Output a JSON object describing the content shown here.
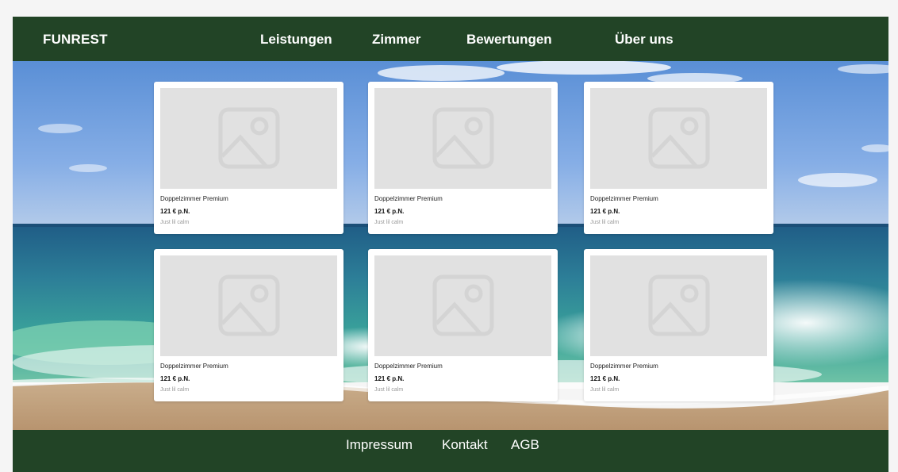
{
  "header": {
    "logo": "FUNREST",
    "nav": [
      {
        "label": "Leistungen"
      },
      {
        "label": "Zimmer"
      },
      {
        "label": "Bewertungen"
      },
      {
        "label": "Über uns"
      }
    ]
  },
  "hero": {
    "background": "beach-with-waves-image"
  },
  "rooms": [
    {
      "title": "Doppelzimmer Premium",
      "price": "121 € p.N.",
      "note": "Just lil calm",
      "image": "image-placeholder-icon"
    },
    {
      "title": "Doppelzimmer Premium",
      "price": "121 € p.N.",
      "note": "Just lil calm",
      "image": "image-placeholder-icon"
    },
    {
      "title": "Doppelzimmer Premium",
      "price": "121 € p.N.",
      "note": "Just lil calm",
      "image": "image-placeholder-icon"
    },
    {
      "title": "Doppelzimmer Premium",
      "price": "121 € p.N.",
      "note": "Just lil calm",
      "image": "image-placeholder-icon"
    },
    {
      "title": "Doppelzimmer Premium",
      "price": "121 € p.N.",
      "note": "Just lil calm",
      "image": "image-placeholder-icon"
    },
    {
      "title": "Doppelzimmer Premium",
      "price": "121 € p.N.",
      "note": "Just lil calm",
      "image": "image-placeholder-icon"
    }
  ],
  "footer": {
    "links": [
      {
        "label": "Impressum"
      },
      {
        "label": "Kontakt"
      },
      {
        "label": "AGB"
      }
    ]
  },
  "colors": {
    "header_bg": "#224426",
    "footer_bg": "#224426",
    "card_bg": "#ffffff",
    "placeholder_bg": "#e1e1e1"
  }
}
